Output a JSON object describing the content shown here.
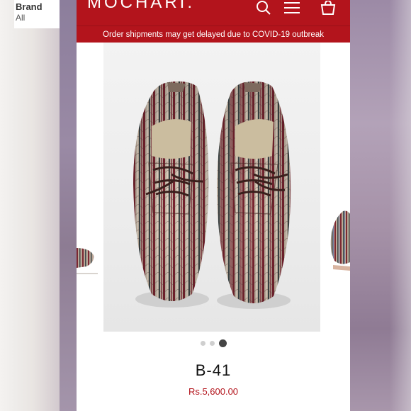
{
  "filter": {
    "title": "Brand",
    "value": "All"
  },
  "header": {
    "logo": "MOCHARI.",
    "icons": [
      "search-icon",
      "menu-icon",
      "cart-icon"
    ],
    "brand_color": "#b3141c"
  },
  "banner": {
    "text": "Order shipments may get delayed due to COVID-19 outbreak"
  },
  "gallery": {
    "slide_count": 3,
    "active_index": 2
  },
  "product": {
    "name": "B-41",
    "price": "Rs.5,600.00"
  }
}
